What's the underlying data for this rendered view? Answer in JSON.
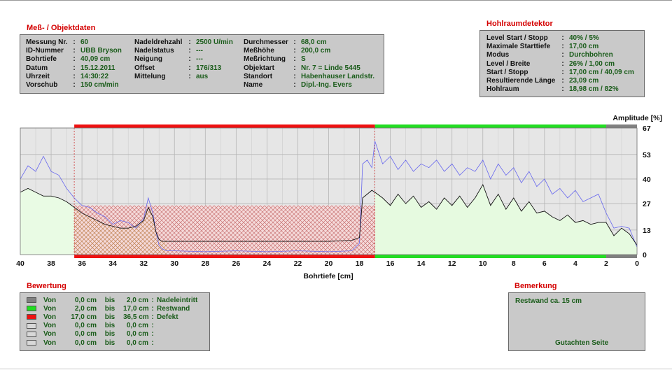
{
  "mess": {
    "title": "Meß- / Objektdaten",
    "col1": [
      {
        "label": "Messung Nr.",
        "value": "60"
      },
      {
        "label": "ID-Nummer",
        "value": "UBB Bryson"
      },
      {
        "label": "Bohrtiefe",
        "value": "40,09 cm"
      },
      {
        "label": "Datum",
        "value": "15.12.2011"
      },
      {
        "label": "Uhrzeit",
        "value": "14:30:22"
      },
      {
        "label": "Vorschub",
        "value": "150 cm/min"
      }
    ],
    "col2": [
      {
        "label": "Nadeldrehzahl",
        "value": "2500 U/min"
      },
      {
        "label": "Nadelstatus",
        "value": "---"
      },
      {
        "label": "Neigung",
        "value": "---"
      },
      {
        "label": "Offset",
        "value": "176/313"
      },
      {
        "label": "Mittelung",
        "value": "aus"
      }
    ],
    "col3": [
      {
        "label": "Durchmesser",
        "value": "68,0 cm"
      },
      {
        "label": "Meßhöhe",
        "value": "200,0 cm"
      },
      {
        "label": "Meßrichtung",
        "value": "S"
      },
      {
        "label": "Objektart",
        "value": "Nr. 7 = Linde 5445"
      },
      {
        "label": "Standort",
        "value": "Habenhauser Landstr."
      },
      {
        "label": "Name",
        "value": "Dipl.-Ing. Evers"
      }
    ]
  },
  "hohl": {
    "title": "Hohlraumdetektor",
    "rows": [
      {
        "label": "Level Start / Stopp",
        "value": "40% / 5%"
      },
      {
        "label": "Maximale Starttiefe",
        "value": "17,00 cm"
      },
      {
        "label": "Modus",
        "value": "Durchbohren"
      },
      {
        "label": "Level / Breite",
        "value": "26% / 1,00 cm"
      },
      {
        "label": "Start / Stopp",
        "value": "17,00 cm / 40,09 cm"
      },
      {
        "label": "Resultierende Länge",
        "value": "23,09 cm"
      },
      {
        "label": "Hohlraum",
        "value": "18,98 cm / 82%"
      }
    ]
  },
  "bewertung": {
    "title": "Bewertung",
    "rows": [
      {
        "von": "Von",
        "from": "0,0 cm",
        "bis": "bis",
        "to": "2,0 cm",
        "label": "Nadeleintritt",
        "color": "#808080"
      },
      {
        "von": "Von",
        "from": "2,0 cm",
        "bis": "bis",
        "to": "17,0 cm",
        "label": "Restwand",
        "color": "#22dd22"
      },
      {
        "von": "Von",
        "from": "17,0 cm",
        "bis": "bis",
        "to": "36,5 cm",
        "label": "Defekt",
        "color": "#ee1111"
      },
      {
        "von": "Von",
        "from": "0,0 cm",
        "bis": "bis",
        "to": "0,0 cm",
        "label": "",
        "color": "#d8d8d8"
      },
      {
        "von": "Von",
        "from": "0,0 cm",
        "bis": "bis",
        "to": "0,0 cm",
        "label": "",
        "color": "#d8d8d8"
      },
      {
        "von": "Von",
        "from": "0,0 cm",
        "bis": "bis",
        "to": "0,0 cm",
        "label": "",
        "color": "#d8d8d8"
      }
    ]
  },
  "bemerkung": {
    "title": "Bemerkung",
    "text": "Restwand ca. 15 cm",
    "footer": "Gutachten Seite"
  },
  "chart_data": {
    "type": "area",
    "xlabel": "Bohrtiefe [cm]",
    "ylabel": "Amplitude [%]",
    "xlim": [
      40,
      0
    ],
    "ylim": [
      0,
      67
    ],
    "x_ticks": [
      40,
      38,
      36,
      34,
      32,
      30,
      28,
      26,
      24,
      22,
      20,
      18,
      16,
      14,
      12,
      10,
      8,
      6,
      4,
      2,
      0
    ],
    "y_ticks": [
      0,
      13,
      27,
      40,
      53,
      67
    ],
    "grid": true,
    "zones": [
      {
        "from": 0,
        "to": 2,
        "color": "#808080",
        "label": "Nadeleintritt"
      },
      {
        "from": 2,
        "to": 17,
        "color": "#22dd22",
        "label": "Restwand"
      },
      {
        "from": 17,
        "to": 36.5,
        "color": "#ee1111",
        "label": "Defekt"
      }
    ],
    "hohlraum_band": {
      "from": 17,
      "to": 36.5,
      "level": 26
    },
    "series": [
      {
        "role": "main",
        "color": "#111111",
        "x": [
          40,
          39.5,
          39,
          38.5,
          38,
          37.5,
          37,
          36.5,
          36,
          35.5,
          35,
          34.5,
          34,
          33.5,
          33,
          32.5,
          32,
          31.7,
          31.4,
          31.2,
          31,
          30.8,
          30.5,
          30,
          28,
          26,
          24,
          22,
          20,
          18.5,
          18,
          17.8,
          17.5,
          17.2,
          17,
          16.5,
          16,
          15.5,
          15,
          14.5,
          14,
          13.5,
          13,
          12.5,
          12,
          11.5,
          11,
          10.5,
          10,
          9.5,
          9,
          8.5,
          8,
          7.5,
          7,
          6.5,
          6,
          5.5,
          5,
          4.5,
          4,
          3.5,
          3,
          2.5,
          2,
          1.5,
          1,
          0.5,
          0
        ],
        "y": [
          33,
          35,
          33,
          31,
          31,
          30,
          28,
          25,
          22,
          20,
          18,
          16,
          15,
          14,
          14,
          15,
          18,
          25,
          20,
          12,
          8,
          7,
          7,
          7,
          7,
          7,
          7,
          7,
          7,
          7.5,
          9,
          30,
          32,
          34,
          33,
          30,
          26,
          32,
          27,
          31,
          25,
          28,
          24,
          30,
          26,
          31,
          25,
          30,
          37,
          26,
          32,
          24,
          30,
          23,
          28,
          22,
          23,
          20,
          18,
          21,
          17,
          18,
          16,
          17,
          17,
          10,
          14,
          11,
          5
        ]
      },
      {
        "role": "secondary",
        "color": "#6666ee",
        "x": [
          40,
          39.5,
          39,
          38.5,
          38,
          37.5,
          37,
          36.5,
          36,
          35.5,
          35,
          34.5,
          34,
          33.5,
          33,
          32.5,
          32,
          31.7,
          31.4,
          31.2,
          31,
          30.8,
          30.5,
          30,
          28,
          26,
          24,
          22,
          20,
          18.5,
          18,
          17.8,
          17.5,
          17.2,
          17,
          16.5,
          16,
          15.5,
          15,
          14.5,
          14,
          13.5,
          13,
          12.5,
          12,
          11.5,
          11,
          10.5,
          10,
          9.5,
          9,
          8.5,
          8,
          7.5,
          7,
          6.5,
          6,
          5.5,
          5,
          4.5,
          4,
          3.5,
          3,
          2.5,
          2,
          1.5,
          1,
          0.5,
          0
        ],
        "y": [
          40,
          47,
          44,
          52,
          44,
          42,
          35,
          30,
          26,
          25,
          22,
          20,
          16,
          18,
          17,
          14,
          19,
          30,
          22,
          12,
          5,
          3,
          2,
          2,
          1.5,
          2,
          1.5,
          2,
          1.5,
          2,
          6,
          48,
          50,
          46,
          60,
          48,
          52,
          45,
          50,
          44,
          48,
          46,
          50,
          44,
          48,
          42,
          46,
          44,
          50,
          40,
          48,
          42,
          46,
          38,
          44,
          36,
          40,
          32,
          35,
          30,
          34,
          28,
          30,
          32,
          22,
          14,
          15,
          14,
          4
        ]
      }
    ]
  }
}
